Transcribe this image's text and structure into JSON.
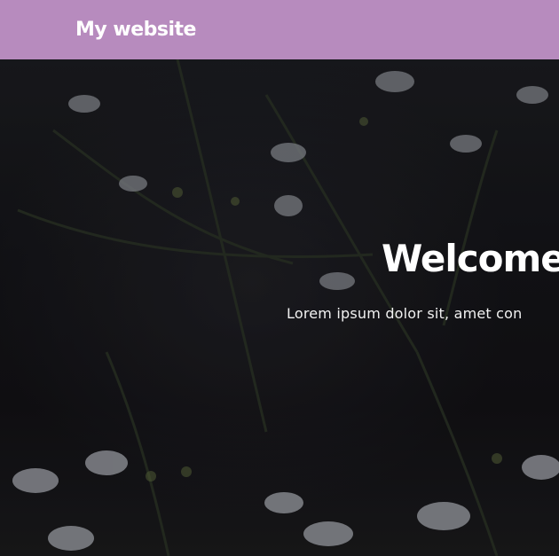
{
  "navbar": {
    "brand": "My website",
    "background": "#b78bbe"
  },
  "hero": {
    "title": "Welcome",
    "subtitle": "Lorem ipsum dolor sit, amet con",
    "background_image": "dark-wildflowers-photo"
  }
}
